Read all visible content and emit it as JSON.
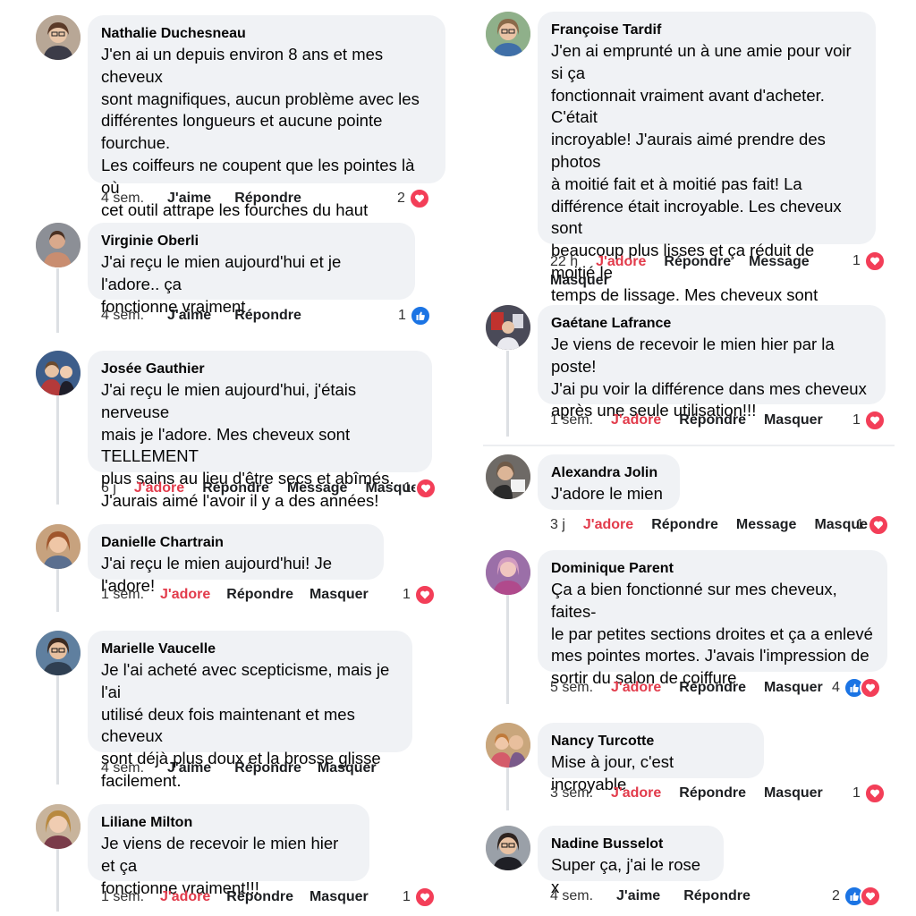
{
  "comments": [
    {
      "name": "Nathalie Duchesneau",
      "text": "J'en ai un depuis environ 8 ans et mes cheveux\nsont magnifiques, aucun problème avec les\ndifférentes longueurs et aucune pointe fourchue.\nLes coiffeurs ne coupent que les pointes là où\ncet outil attrape les fourches du haut jusqu'en\nbas. Pour info, je suis coiffeuse qualifiée",
      "time": "4 sem.",
      "like": "J'aime",
      "reply": "Répondre",
      "count": "2"
    },
    {
      "name": "Virginie Oberli",
      "text": "J'ai reçu le mien aujourd'hui et je l'adore.. ça\nfonctionne vraiment",
      "time": "4 sem.",
      "like": "J'aime",
      "reply": "Répondre",
      "count": "1"
    },
    {
      "name": "Josée Gauthier",
      "text": "J'ai reçu le mien aujourd'hui, j'étais nerveuse\nmais je l'adore. Mes cheveux sont TELLEMENT\nplus sains au lieu d'être secs et abîmés.\nJ'aurais aimé l'avoir il y a des années!",
      "time": "6 j",
      "like": "J'adore",
      "reply": "Répondre",
      "message": "Message",
      "hide": "Masquer",
      "count": "1"
    },
    {
      "name": "Danielle Chartrain",
      "text": "J'ai reçu le mien aujourd'hui! Je l'adore!",
      "time": "1 sem.",
      "like": "J'adore",
      "reply": "Répondre",
      "hide": "Masquer",
      "count": "1"
    },
    {
      "name": "Marielle Vaucelle",
      "text": "Je l'ai acheté avec scepticisme, mais je l'ai\nutilisé deux fois maintenant et mes cheveux\nsont déjà plus doux et la brosse glisse\nfacilement.",
      "time": "4 sem.",
      "like": "J'aime",
      "reply": "Répondre",
      "hide": "Masquer"
    },
    {
      "name": "Liliane Milton",
      "text": "Je viens de recevoir le mien hier et ça\nfonctionne vraiment!!!",
      "time": "1 sem.",
      "like": "J'adore",
      "reply": "Répondre",
      "hide": "Masquer",
      "count": "1"
    },
    {
      "name": "Françoise Tardif",
      "text": "J'en ai emprunté un à une amie pour voir si ça\nfonctionnait vraiment avant d'acheter. C'était\nincroyable! J'aurais aimé prendre des photos\nà moitié fait et à moitié pas fait! La\ndifférence était incroyable. Les cheveux sont\nbeaucoup plus lisses et ça réduit de moitié le\ntemps de lissage. Mes cheveux sont vraiment\nagréables au toucher. J'en ai commandé un,\nc'est indispensable.",
      "time": "22 h",
      "like": "J'adore",
      "reply": "Répondre",
      "message": "Message",
      "hide": "Masquer",
      "count": "1"
    },
    {
      "name": "Gaétane Lafrance",
      "text": "Je viens de recevoir le mien hier par la poste!\nJ'ai pu voir la différence dans mes cheveux\naprès une seule utilisation!!!",
      "time": "1 sem.",
      "like": "J'adore",
      "reply": "Répondre",
      "hide": "Masquer",
      "count": "1"
    },
    {
      "name": "Alexandra Jolin",
      "text": "J'adore le mien",
      "time": "3 j",
      "like": "J'adore",
      "reply": "Répondre",
      "message": "Message",
      "hide": "Masquer",
      "count": "1"
    },
    {
      "name": "Dominique Parent",
      "text": "Ça a bien fonctionné sur mes cheveux, faites-\nle par petites sections droites et ça a enlevé\nmes pointes mortes. J'avais l'impression de\nsortir du salon de coiffure",
      "time": "5 sem.",
      "like": "J'adore",
      "reply": "Répondre",
      "hide": "Masquer",
      "count": "4"
    },
    {
      "name": "Nancy Turcotte",
      "text": "Mise à jour, c'est incroyable",
      "time": "3 sem.",
      "like": "J'adore",
      "reply": "Répondre",
      "hide": "Masquer",
      "count": "1"
    },
    {
      "name": "Nadine Busselot",
      "text": "Super ça, j'ai le rose x",
      "time": "4 sem.",
      "like": "J'aime",
      "reply": "Répondre",
      "count": "2"
    }
  ],
  "colors": {
    "accent_love": "#e23b4b",
    "bubble": "#f0f2f5",
    "like_blue": "#1b74e4",
    "heart_red": "#f33e58"
  }
}
